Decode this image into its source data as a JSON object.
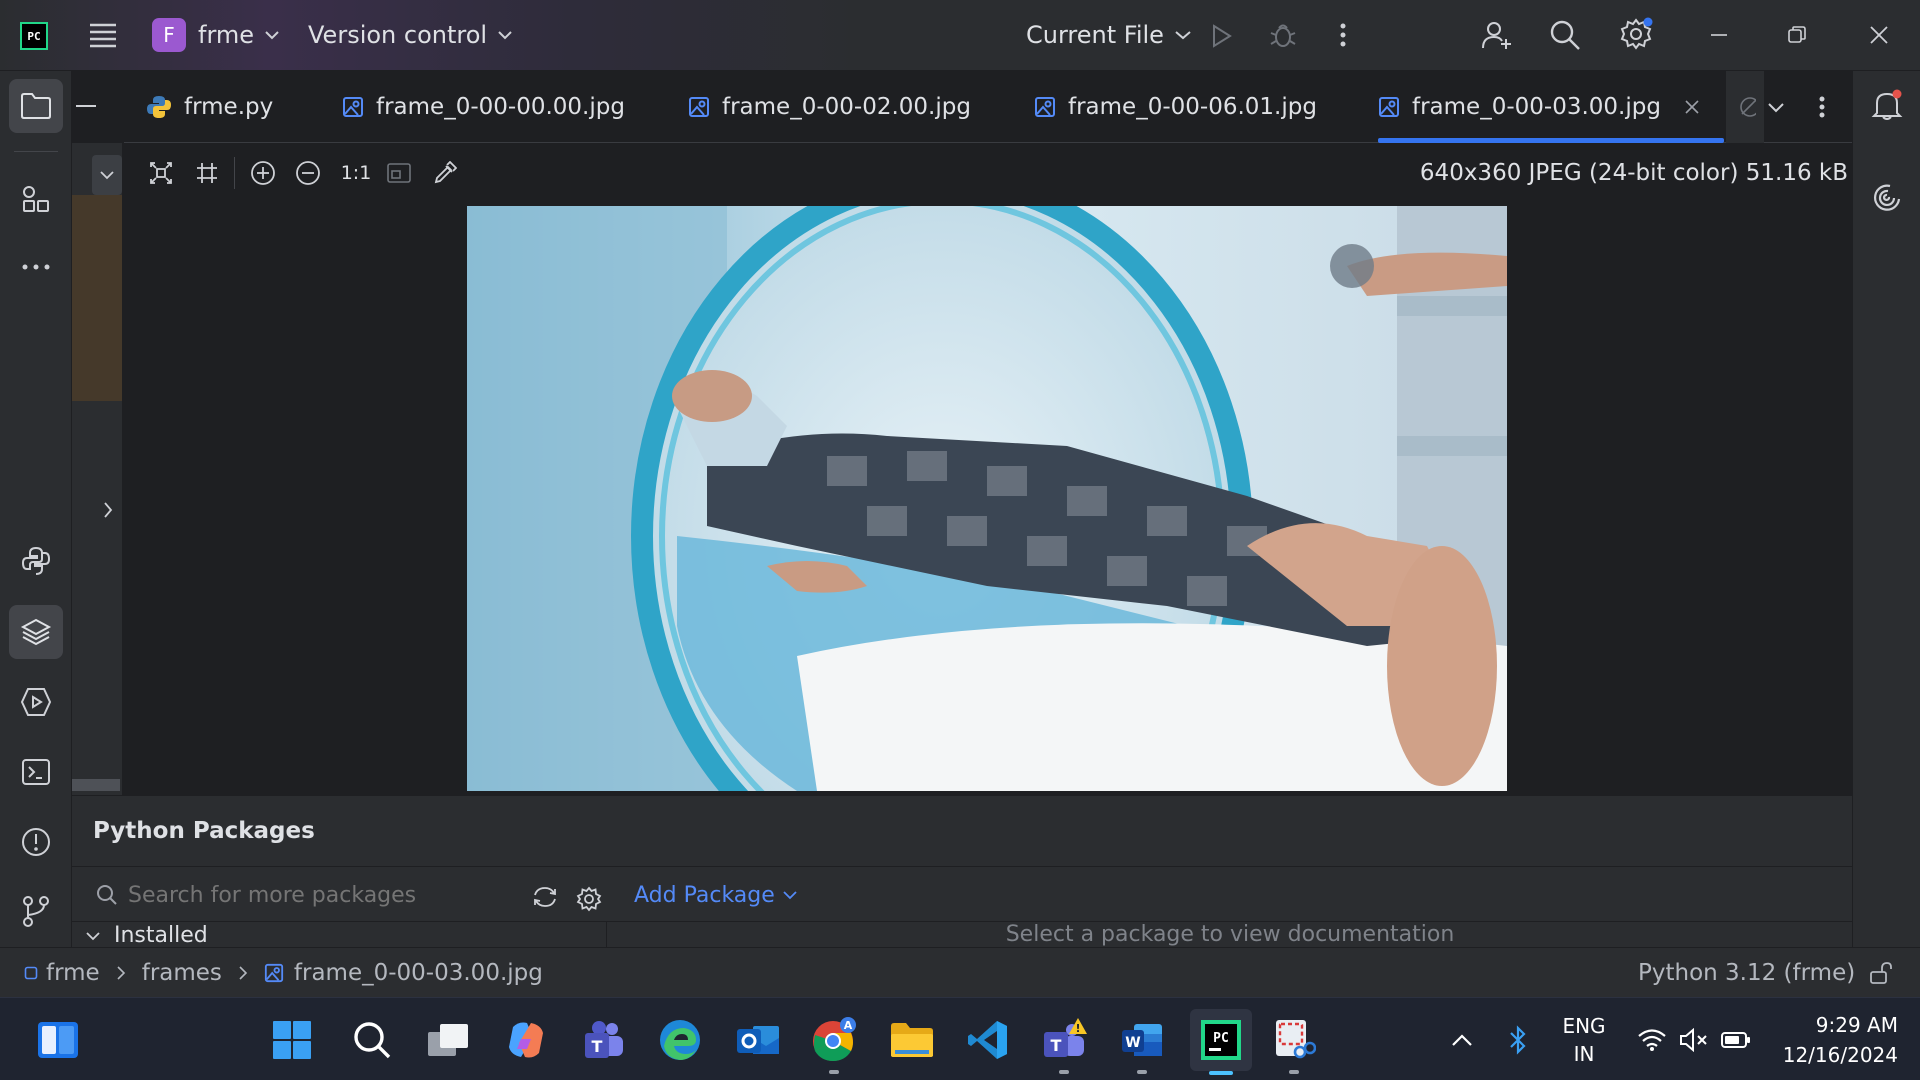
{
  "titlebar": {
    "project_letter": "F",
    "project_name": "frme",
    "version_control": "Version control",
    "run_config": "Current File"
  },
  "tabs": [
    {
      "label": "frme.py",
      "active": false
    },
    {
      "label": "frame_0-00-00.00.jpg",
      "active": false
    },
    {
      "label": "frame_0-00-02.00.jpg",
      "active": false
    },
    {
      "label": "frame_0-00-06.01.jpg",
      "active": false
    },
    {
      "label": "frame_0-00-03.00.jpg",
      "active": true
    }
  ],
  "image_toolbar": {
    "actual_size_label": "1:1",
    "image_info": "640x360 JPEG (24-bit color) 51.16 kB"
  },
  "packages": {
    "title": "Python Packages",
    "search_placeholder": "Search for more packages",
    "add_package": "Add Package",
    "installed": "Installed",
    "doc_hint": "Select a package to view documentation"
  },
  "statusbar": {
    "crumbs": [
      "frme",
      "frames",
      "frame_0-00-03.00.jpg"
    ],
    "interpreter": "Python 3.12 (frme)"
  },
  "taskbar": {
    "lang_top": "ENG",
    "lang_bottom": "IN",
    "time": "9:29 AM",
    "date": "12/16/2024"
  },
  "colors": {
    "accent": "#3574f0",
    "project_badge": "#9b59d0",
    "pycharm_green": "#21d789"
  }
}
